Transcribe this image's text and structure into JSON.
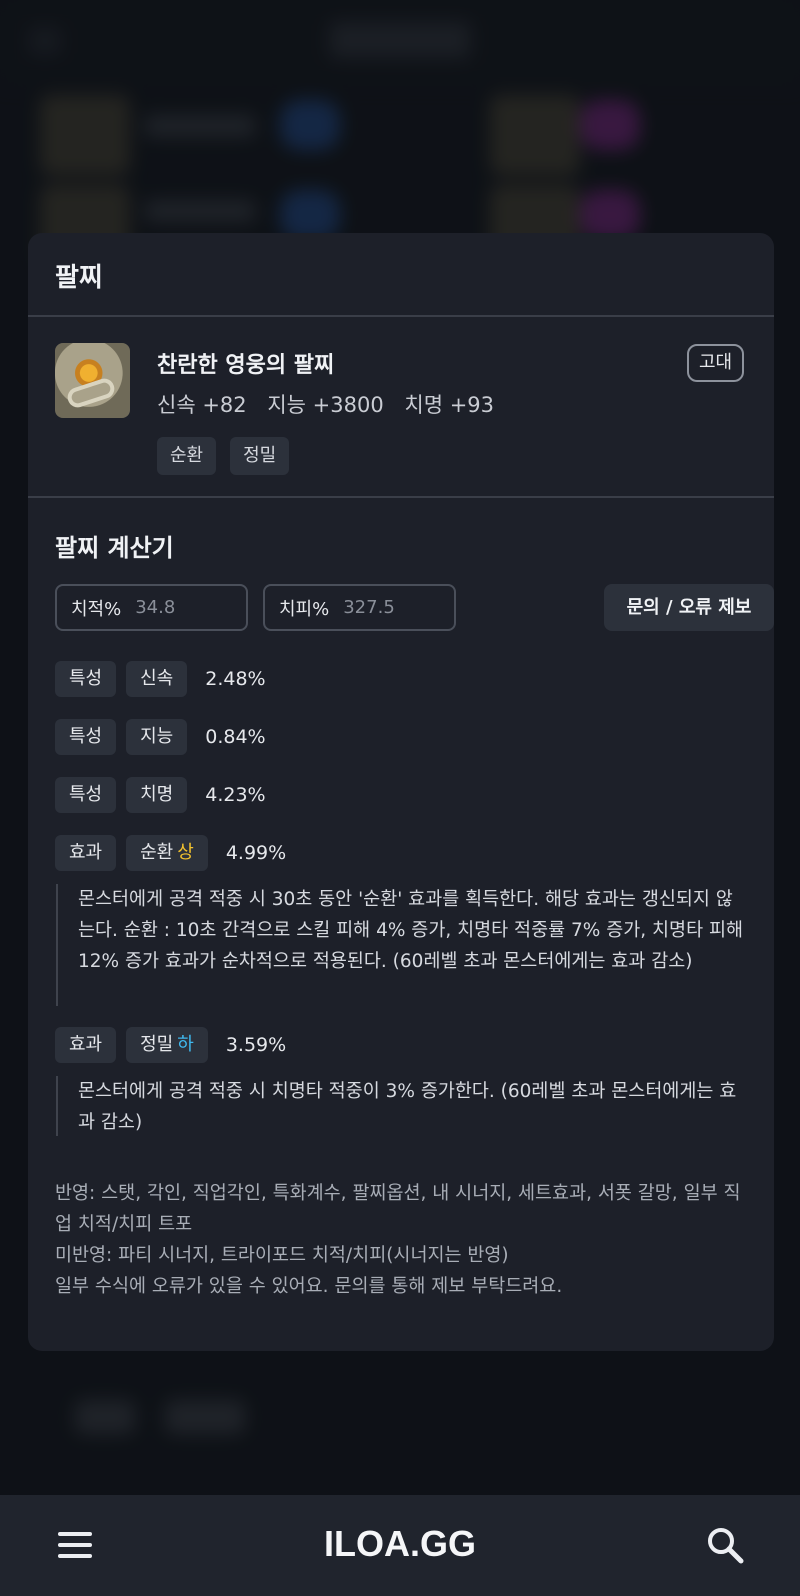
{
  "modal": {
    "title": "팔찌",
    "item": {
      "name": "찬란한 영웅의 팔찌",
      "stats": [
        "신속 +82",
        "지능 +3800",
        "치명 +93"
      ],
      "grade": "고대",
      "tags": [
        "순환",
        "정밀"
      ]
    },
    "calculator": {
      "title": "팔찌 계산기",
      "crit_rate": {
        "label": "치적%",
        "placeholder": "34.8"
      },
      "crit_dmg": {
        "label": "치피%",
        "placeholder": "327.5"
      },
      "inquiry_button": "문의 / 오류 제보",
      "rows": [
        {
          "type": "특성",
          "name": "신속",
          "value": "2.48%"
        },
        {
          "type": "특성",
          "name": "지능",
          "value": "0.84%"
        },
        {
          "type": "특성",
          "name": "치명",
          "value": "4.23%"
        }
      ],
      "effects": [
        {
          "type": "효과",
          "name": "순환",
          "grade": "상",
          "grade_color": "#f2c12e",
          "value": "4.99%",
          "description": "몬스터에게 공격 적중 시 30초 동안 '순환' 효과를 획득한다. 해당 효과는 갱신되지 않는다. 순환 : 10초 간격으로 스킬 피해 4% 증가, 치명타 적중률 7% 증가, 치명타 피해 12% 증가 효과가 순차적으로 적용된다. (60레벨 초과 몬스터에게는 효과 감소)"
        },
        {
          "type": "효과",
          "name": "정밀",
          "grade": "하",
          "grade_color": "#3fb8ee",
          "value": "3.59%",
          "description": "몬스터에게 공격 적중 시 치명타 적중이 3% 증가한다. (60레벨 초과 몬스터에게는 효과 감소)"
        }
      ],
      "notes": {
        "applied": "반영: 스탯, 각인, 직업각인, 특화계수, 팔찌옵션, 내 시너지, 세트효과, 서폿 갈망, 일부 직업 치적/치피 트포",
        "not_applied": "미반영: 파티 시너지, 트라이포드 치적/치피(시너지는 반영)",
        "disclaimer": "일부 수식에 오류가 있을 수 있어요. 문의를 통해 제보 부탁드려요."
      }
    }
  },
  "bottom_nav": {
    "brand": "ILOA.GG",
    "menu_icon": "hamburger-menu-icon",
    "search_icon": "search-icon"
  }
}
